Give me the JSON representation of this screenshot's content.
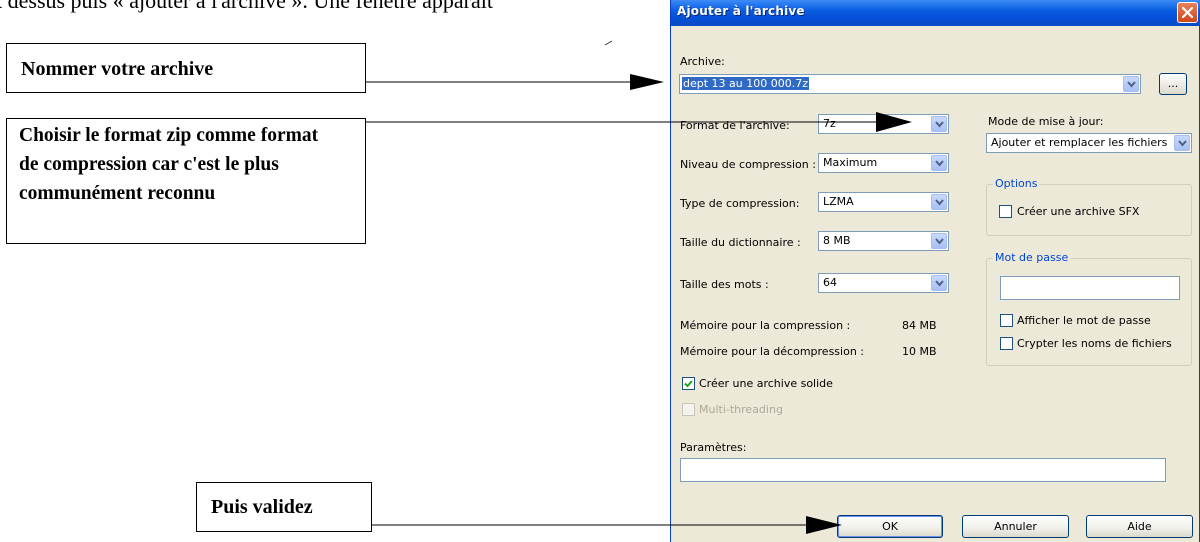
{
  "document": {
    "top_text": "t dessus puis « ajouter à l'archive ». Une fenêtre apparaît"
  },
  "callouts": [
    {
      "text": "Nommer votre archive"
    },
    {
      "text": "Choisir le format zip comme format de compression car c'est le plus communément reconnu"
    },
    {
      "text": "Puis validez"
    }
  ],
  "dialog": {
    "title": "Ajouter à l'archive",
    "archive_label": "Archive:",
    "archive_value": "dept 13 au 100 000.7z",
    "browse_label": "...",
    "format_label": "Format de l'archive:",
    "format_value": "7z",
    "level_label": "Niveau de compression :",
    "level_value": "Maximum",
    "type_label": "Type de compression:",
    "type_value": "LZMA",
    "dict_label": "Taille du dictionnaire :",
    "dict_value": "8 MB",
    "words_label": "Taille des mots :",
    "words_value": "64",
    "mem_comp_label": "Mémoire pour la compression :",
    "mem_comp_value": "84 MB",
    "mem_decomp_label": "Mémoire pour la décompression :",
    "mem_decomp_value": "10 MB",
    "solid_label": "Créer une archive solide",
    "multithread_label": "Multi-threading",
    "params_label": "Paramètres:",
    "update_mode_label": "Mode de mise à jour:",
    "update_mode_value": "Ajouter et remplacer les fichiers",
    "options_legend": "Options",
    "sfx_label": "Créer une archive SFX",
    "password_legend": "Mot de passe",
    "show_password_label": "Afficher le mot de passe",
    "encrypt_names_label": "Crypter les noms de fichiers",
    "ok_label": "OK",
    "cancel_label": "Annuler",
    "help_label": "Aide",
    "solid_checked": true,
    "multithread_checked": false,
    "sfx_checked": false,
    "show_password_checked": false,
    "encrypt_names_checked": false
  },
  "colors": {
    "titlebar": "#0a5de0",
    "dialog_bg": "#ece9d8",
    "groupbox_legend": "#0046d5",
    "close_button": "#d2451c"
  }
}
